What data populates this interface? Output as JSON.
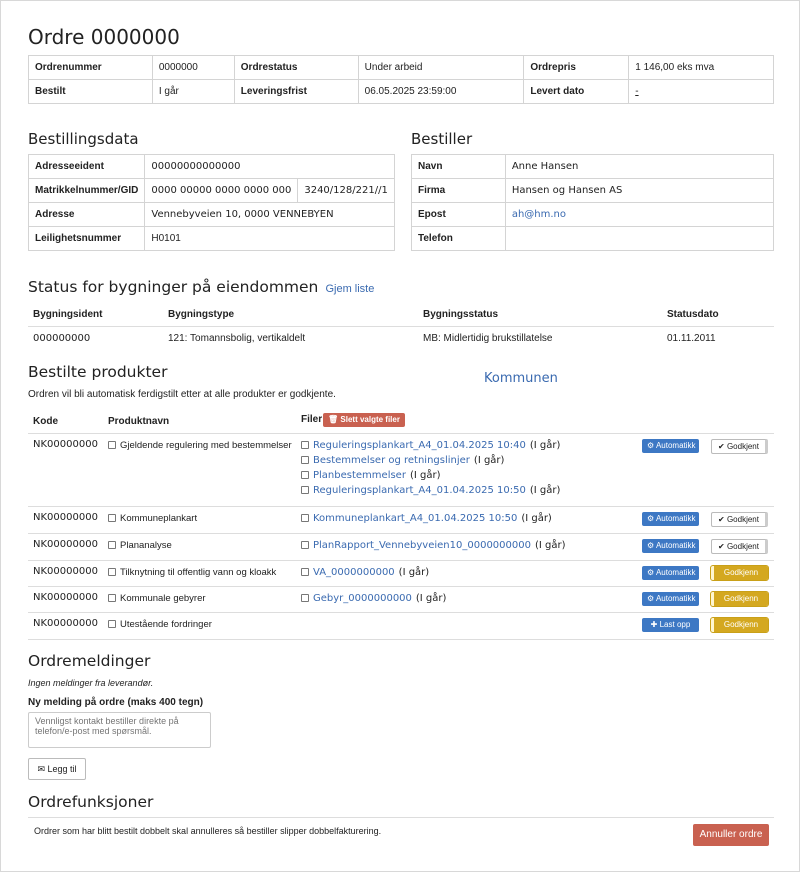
{
  "title": "Ordre 0000000",
  "order": {
    "nr_label": "Ordrenummer",
    "nr_value": "0000000",
    "status_label": "Ordrestatus",
    "status_value": "Under arbeid",
    "price_label": "Ordrepris",
    "price_value": "1 146,00 eks mva",
    "ordered_label": "Bestilt",
    "ordered_value": "I går",
    "deadline_label": "Leveringsfrist",
    "deadline_value": "06.05.2025 23:59:00",
    "delivered_label": "Levert dato",
    "delivered_value": "-"
  },
  "bestillingsdata": {
    "heading": "Bestillingsdata",
    "adresseeident_label": "Adresseeident",
    "adresseeident_value": "00000000000000",
    "matrikkel_label": "Matrikkelnummer/GID",
    "matrikkel_value": "0000 00000 0000 0000 000",
    "matrikkel_value2": "3240/128/221//1",
    "adresse_label": "Adresse",
    "adresse_value": "Vennebyveien 10, 0000 VENNEBYEN",
    "leilighet_label": "Leilighetsnummer",
    "leilighet_value": "H0101"
  },
  "bestiller": {
    "heading": "Bestiller",
    "navn_label": "Navn",
    "navn_value": "Anne Hansen",
    "firma_label": "Firma",
    "firma_value": "Hansen og Hansen AS",
    "epost_label": "Epost",
    "epost_value": "ah@hm.no",
    "telefon_label": "Telefon",
    "telefon_value": ""
  },
  "buildings": {
    "heading": "Status for bygninger på eiendommen",
    "hide_link": "Gjem liste",
    "headers": [
      "Bygningsident",
      "Bygningstype",
      "Bygningsstatus",
      "Statusdato"
    ],
    "rows": [
      [
        "000000000",
        "121: Tomannsbolig, vertikaldelt",
        "MB: Midlertidig brukstillatelse",
        "01.11.2011"
      ]
    ]
  },
  "products": {
    "heading": "Bestilte produkter",
    "note": "Ordren vil bli automatisk ferdigstilt etter at alle produkter er godkjente.",
    "kommunen": "Kommunen",
    "col_kode": "Kode",
    "col_navn": "Produktnavn",
    "col_filer": "Filer",
    "delete_btn": "Slett valgte filer",
    "rows": [
      {
        "kode": "NK00000000",
        "navn": "Gjeldende regulering med bestemmelser",
        "files": [
          {
            "name": "Reguleringsplankart_A4_01.04.2025 10:40",
            "when": "(I går)"
          },
          {
            "name": "Bestemmelser og retningslinjer",
            "when": "(I går)"
          },
          {
            "name": "Planbestemmelser",
            "when": "(I går)"
          },
          {
            "name": "Reguleringsplankart_A4_01.04.2025 10:50",
            "when": "(I går)"
          }
        ],
        "action": "Automatikk",
        "approve": "Godkjent",
        "approve_state": "ok"
      },
      {
        "kode": "NK00000000",
        "navn": "Kommuneplankart",
        "files": [
          {
            "name": "Kommuneplankart_A4_01.04.2025 10:50",
            "when": "(I går)"
          }
        ],
        "action": "Automatikk",
        "approve": "Godkjent",
        "approve_state": "ok"
      },
      {
        "kode": "NK00000000",
        "navn": "Plananalyse",
        "files": [
          {
            "name": "PlanRapport_Vennebyveien10_0000000000",
            "when": "(I går)"
          }
        ],
        "action": "Automatikk",
        "approve": "Godkjent",
        "approve_state": "ok"
      },
      {
        "kode": "NK00000000",
        "navn": "Tilknytning til offentlig vann og kloakk",
        "files": [
          {
            "name": "VA_0000000000",
            "when": "(I går)"
          }
        ],
        "action": "Automatikk",
        "approve": "Godkjenn",
        "approve_state": "warn"
      },
      {
        "kode": "NK00000000",
        "navn": "Kommunale gebyrer",
        "files": [
          {
            "name": "Gebyr_0000000000",
            "when": "(I går)"
          }
        ],
        "action": "Automatikk",
        "approve": "Godkjenn",
        "approve_state": "warn"
      },
      {
        "kode": "NK00000000",
        "navn": "Utestående fordringer",
        "files": [],
        "action": "Last opp",
        "approve": "Godkjenn",
        "approve_state": "warn"
      }
    ]
  },
  "messages": {
    "heading": "Ordremeldinger",
    "none": "Ingen meldinger fra leverandør.",
    "new_label": "Ny melding på ordre (maks 400 tegn)",
    "placeholder": "Vennligst kontakt bestiller direkte på telefon/e-post med spørsmål.",
    "add_btn": "Legg til"
  },
  "functions": {
    "heading": "Ordrefunksjoner",
    "text": "Ordrer som har blitt bestilt dobbelt skal annulleres så bestiller slipper dobbelfakturering.",
    "cancel_btn": "Annuller ordre"
  },
  "colors": {
    "link": "#3a6ab0",
    "blue_btn": "#3d78c4",
    "warn_btn": "#d4a820",
    "danger_btn": "#c96150"
  }
}
